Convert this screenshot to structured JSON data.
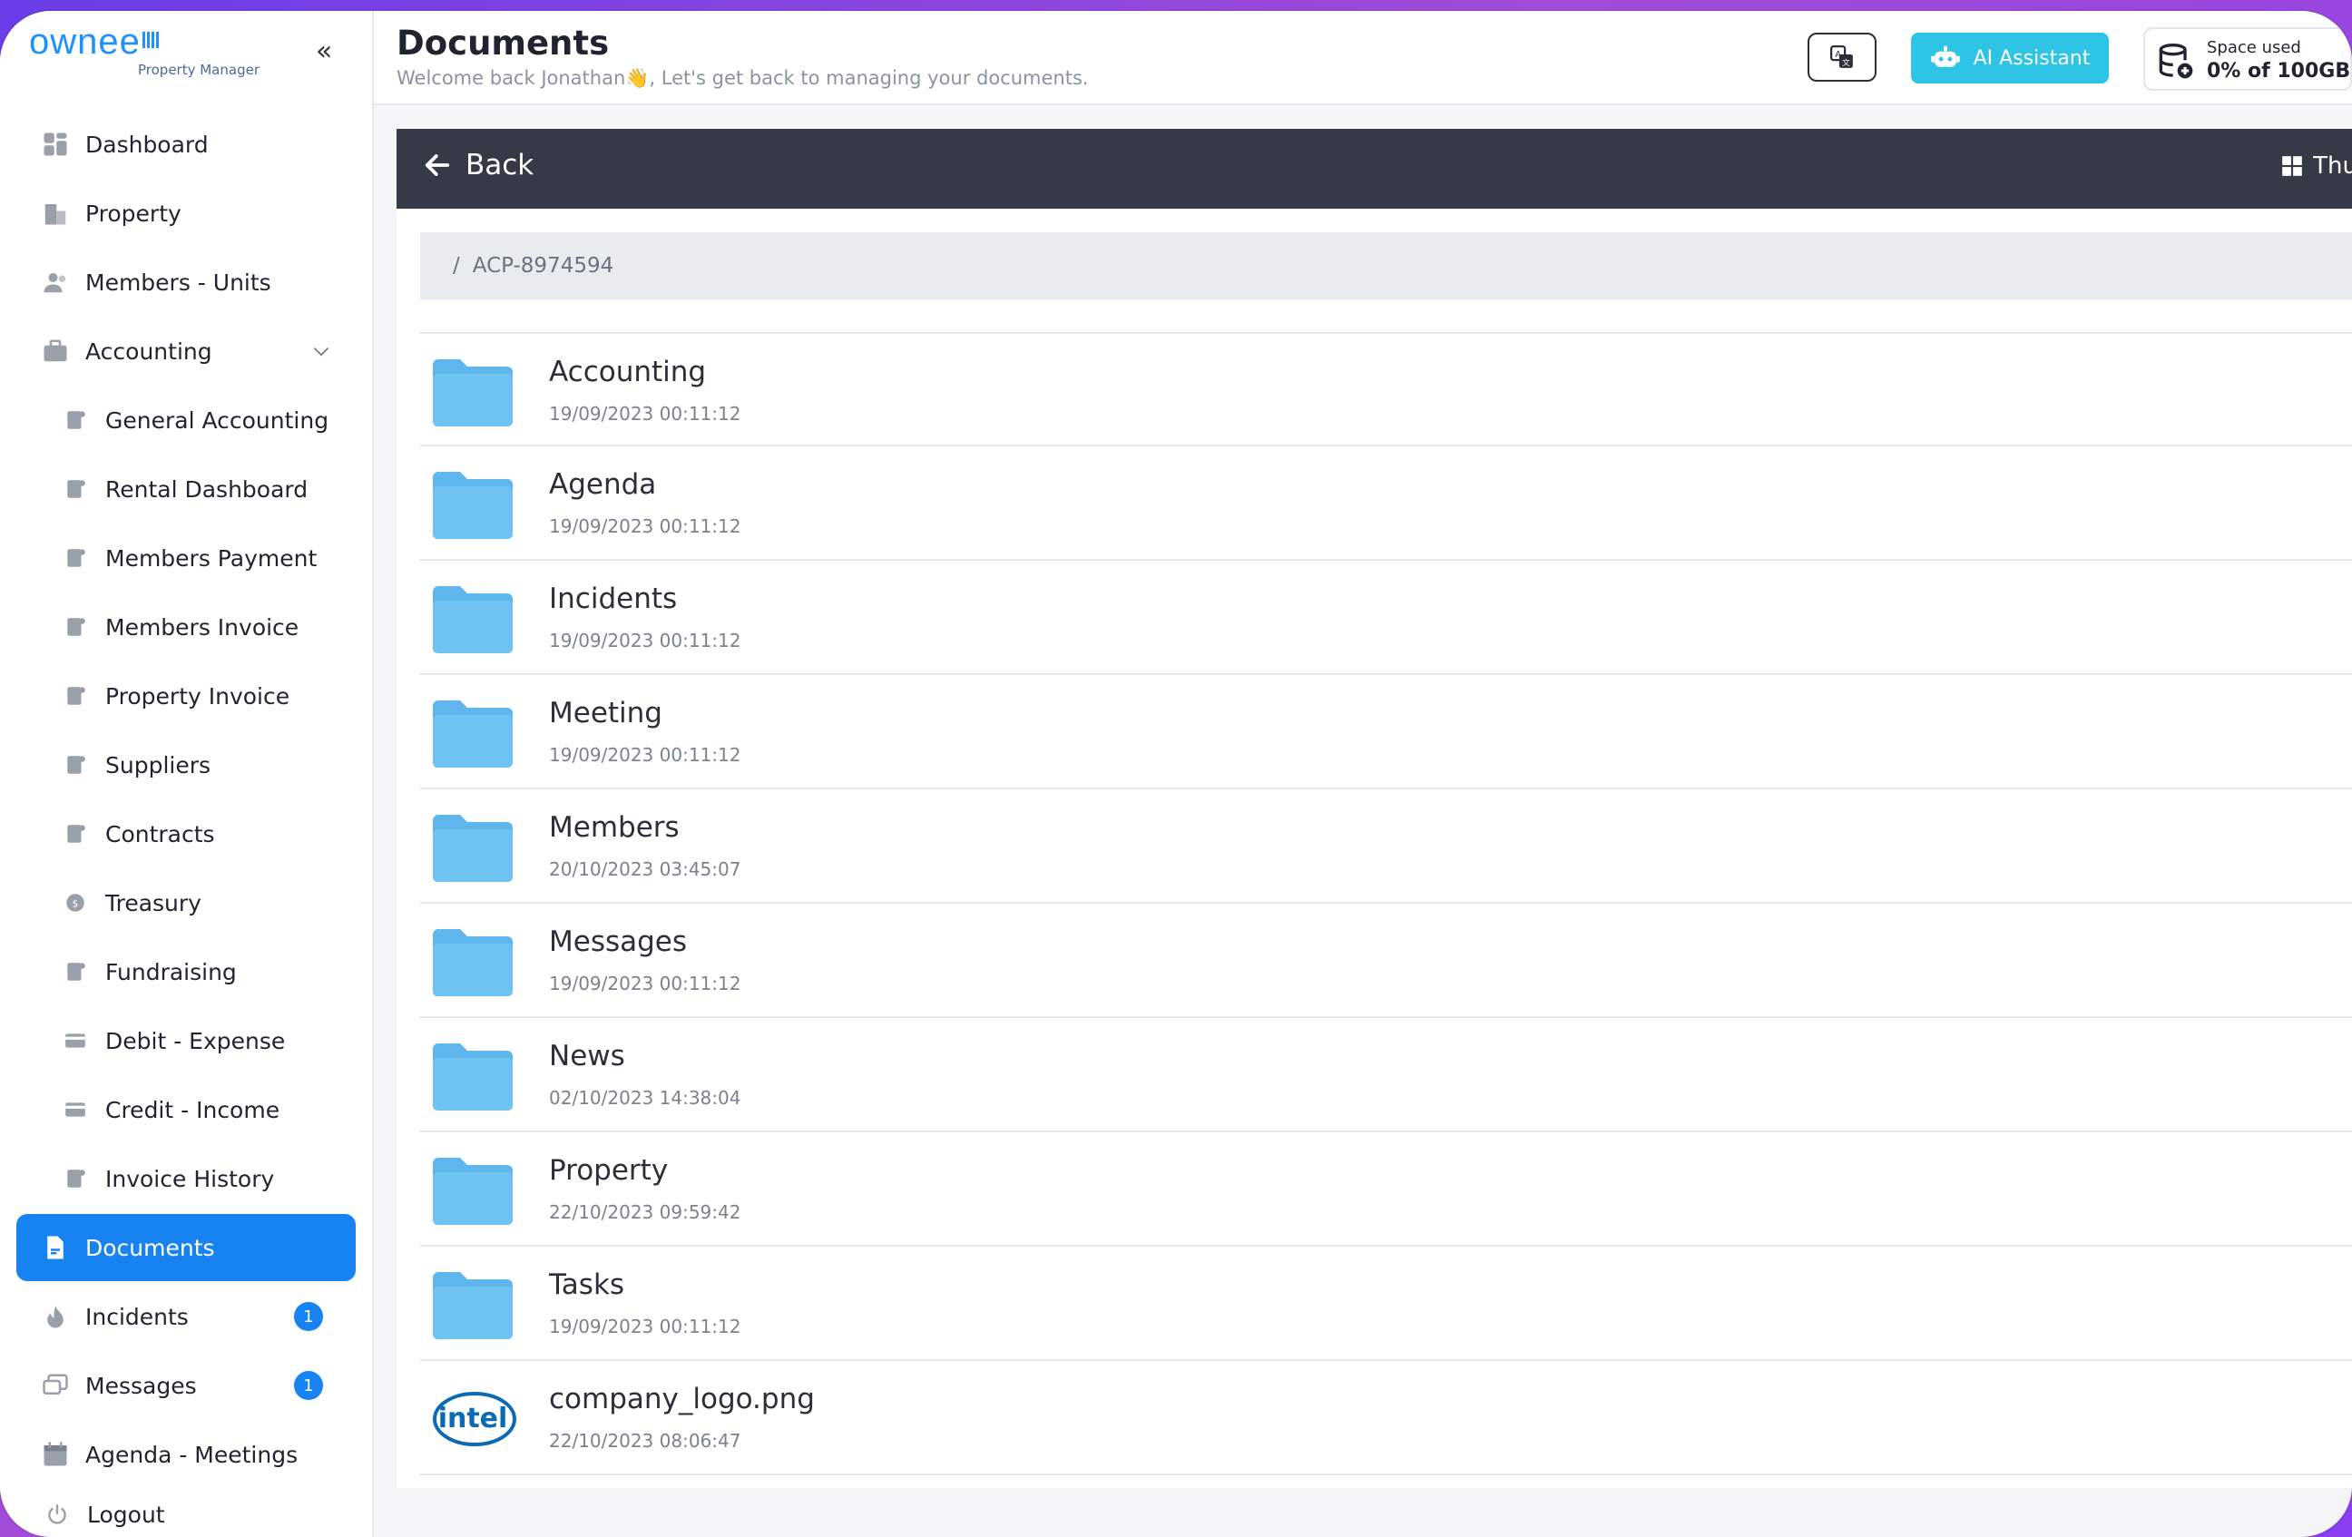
{
  "app": {
    "brand": "ownee",
    "brand_sub": "Property Manager",
    "collapse_glyph": "«"
  },
  "sidebar": {
    "items": [
      {
        "label": "Dashboard",
        "icon": "dashboard-icon"
      },
      {
        "label": "Property",
        "icon": "building-icon"
      },
      {
        "label": "Members - Units",
        "icon": "users-icon"
      },
      {
        "label": "Accounting",
        "icon": "briefcase-icon",
        "expanded": true
      },
      {
        "label": "General Accounting",
        "icon": "ledger-icon",
        "sub": true
      },
      {
        "label": "Rental Dashboard",
        "icon": "rental-icon",
        "sub": true
      },
      {
        "label": "Members Payment",
        "icon": "payment-icon",
        "sub": true
      },
      {
        "label": "Members Invoice",
        "icon": "invoice-icon",
        "sub": true
      },
      {
        "label": "Property Invoice",
        "icon": "property-invoice-icon",
        "sub": true
      },
      {
        "label": "Suppliers",
        "icon": "roller-icon",
        "sub": true
      },
      {
        "label": "Contracts",
        "icon": "contract-icon",
        "sub": true
      },
      {
        "label": "Treasury",
        "icon": "coin-icon",
        "sub": true
      },
      {
        "label": "Fundraising",
        "icon": "piggy-icon",
        "sub": true
      },
      {
        "label": "Debit - Expense",
        "icon": "card-icon",
        "sub": true
      },
      {
        "label": "Credit - Income",
        "icon": "card-icon",
        "sub": true
      },
      {
        "label": "Invoice History",
        "icon": "history-icon",
        "sub": true
      },
      {
        "label": "Documents",
        "icon": "document-icon",
        "active": true
      },
      {
        "label": "Incidents",
        "icon": "flame-icon",
        "badge": "1"
      },
      {
        "label": "Messages",
        "icon": "message-icon",
        "badge": "1"
      },
      {
        "label": "Agenda - Meetings",
        "icon": "calendar-icon"
      }
    ],
    "logout": "Logout"
  },
  "header": {
    "title": "Documents",
    "subtitle": "Welcome back Jonathan👋, Let's get back to managing your documents.",
    "ai_button": "AI Assistant",
    "space_label": "Space used",
    "space_value": "0% of 100GB"
  },
  "toolbar": {
    "back_label": "Back",
    "view_label": "Thu"
  },
  "breadcrumb": {
    "separator": "/",
    "path": "ACP-8974594"
  },
  "files": [
    {
      "name": "Accounting",
      "date": "19/09/2023 00:11:12",
      "type": "folder"
    },
    {
      "name": "Agenda",
      "date": "19/09/2023 00:11:12",
      "type": "folder"
    },
    {
      "name": "Incidents",
      "date": "19/09/2023 00:11:12",
      "type": "folder"
    },
    {
      "name": "Meeting",
      "date": "19/09/2023 00:11:12",
      "type": "folder"
    },
    {
      "name": "Members",
      "date": "20/10/2023 03:45:07",
      "type": "folder"
    },
    {
      "name": "Messages",
      "date": "19/09/2023 00:11:12",
      "type": "folder"
    },
    {
      "name": "News",
      "date": "02/10/2023 14:38:04",
      "type": "folder"
    },
    {
      "name": "Property",
      "date": "22/10/2023 09:59:42",
      "type": "folder"
    },
    {
      "name": "Tasks",
      "date": "19/09/2023 00:11:12",
      "type": "folder"
    },
    {
      "name": "company_logo.png",
      "date": "22/10/2023 08:06:47",
      "type": "image",
      "thumb_text": "intel"
    }
  ],
  "colors": {
    "accent": "#1783f2",
    "ai": "#2ec4e6",
    "toolbar": "#353a46",
    "folder": "#6fc3f3"
  }
}
